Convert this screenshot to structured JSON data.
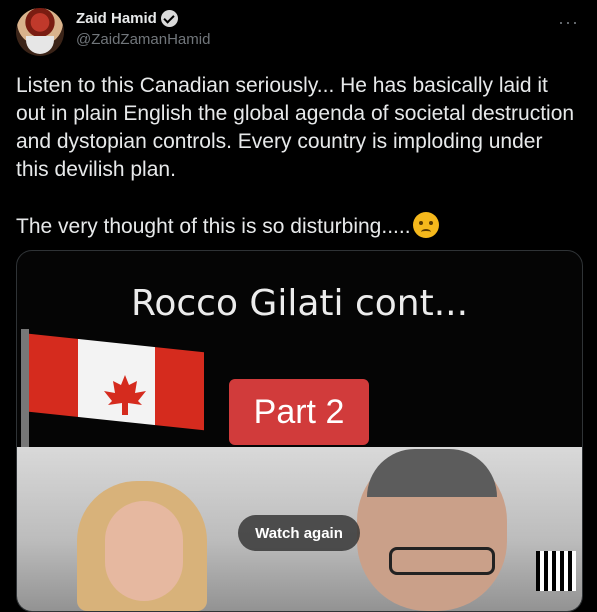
{
  "tweet": {
    "author_name": "Zaid Hamid",
    "author_handle": "@ZaidZamanHamid",
    "more_icon": "more-icon",
    "text": "Listen to this Canadian seriously... He has basically laid it out in plain English the global agenda of societal destruction and dystopian controls. Every country is imploding under this devilish plan.\n\nThe very thought of this is so disturbing.....",
    "emoji_icon": "angry-face-icon"
  },
  "video": {
    "caption": "Rocco Gilati cont...",
    "badge": "Part 2",
    "watch_again_label": "Watch again"
  }
}
